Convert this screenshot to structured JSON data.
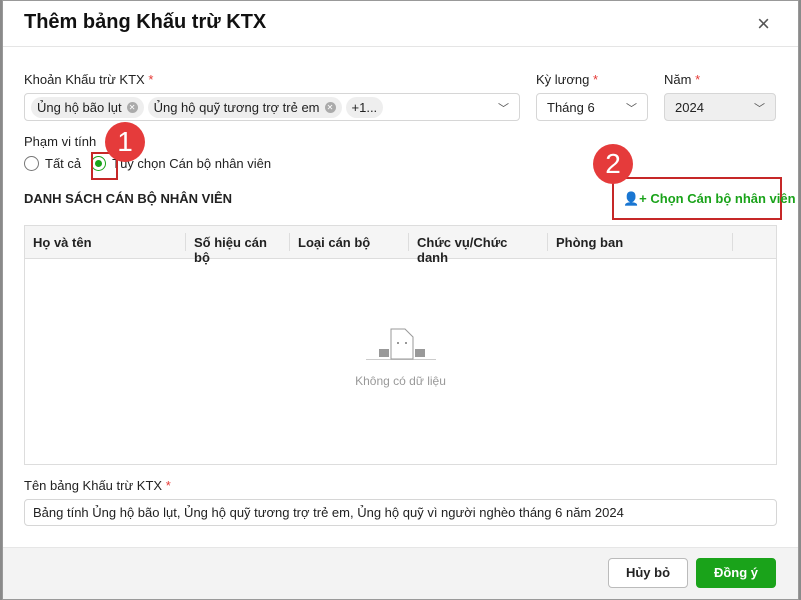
{
  "dialog": {
    "title": "Thêm bảng Khấu trừ KTX",
    "close_icon": "×"
  },
  "fields": {
    "khoan": {
      "label": "Khoản Khấu trừ KTX",
      "required": "*",
      "tags": [
        "Ủng hộ bão lụt",
        "Ủng hộ quỹ tương trợ trẻ em"
      ],
      "more": "+1..."
    },
    "ky_luong": {
      "label": "Kỳ lương",
      "required": "*",
      "value": "Tháng 6"
    },
    "nam": {
      "label": "Năm",
      "required": "*",
      "value": "2024"
    }
  },
  "scope": {
    "label": "Phạm vi tính",
    "options": [
      "Tất cả",
      "Tùy chọn Cán bộ nhân viên"
    ],
    "selected": 1
  },
  "list": {
    "title": "DANH SÁCH CÁN BỘ NHÂN VIÊN",
    "choose_button": "Chọn Cán bộ nhân viên",
    "columns": [
      "Họ và tên",
      "Số hiệu cán bộ",
      "Loại cán bộ",
      "Chức vụ/Chức danh",
      "Phòng ban"
    ],
    "empty": "Không có dữ liệu"
  },
  "name_field": {
    "label": "Tên bảng Khấu trừ KTX",
    "required": "*",
    "value": "Bảng tính Ủng hộ bão lụt, Ủng hộ quỹ tương trợ trẻ em, Ủng hộ quỹ vì người nghèo tháng 6 năm 2024"
  },
  "annotations": [
    "1",
    "2"
  ],
  "footer": {
    "cancel": "Hủy bỏ",
    "ok": "Đồng ý"
  },
  "colors": {
    "accent": "#1aa31a",
    "annotation": "#e53b3b"
  }
}
